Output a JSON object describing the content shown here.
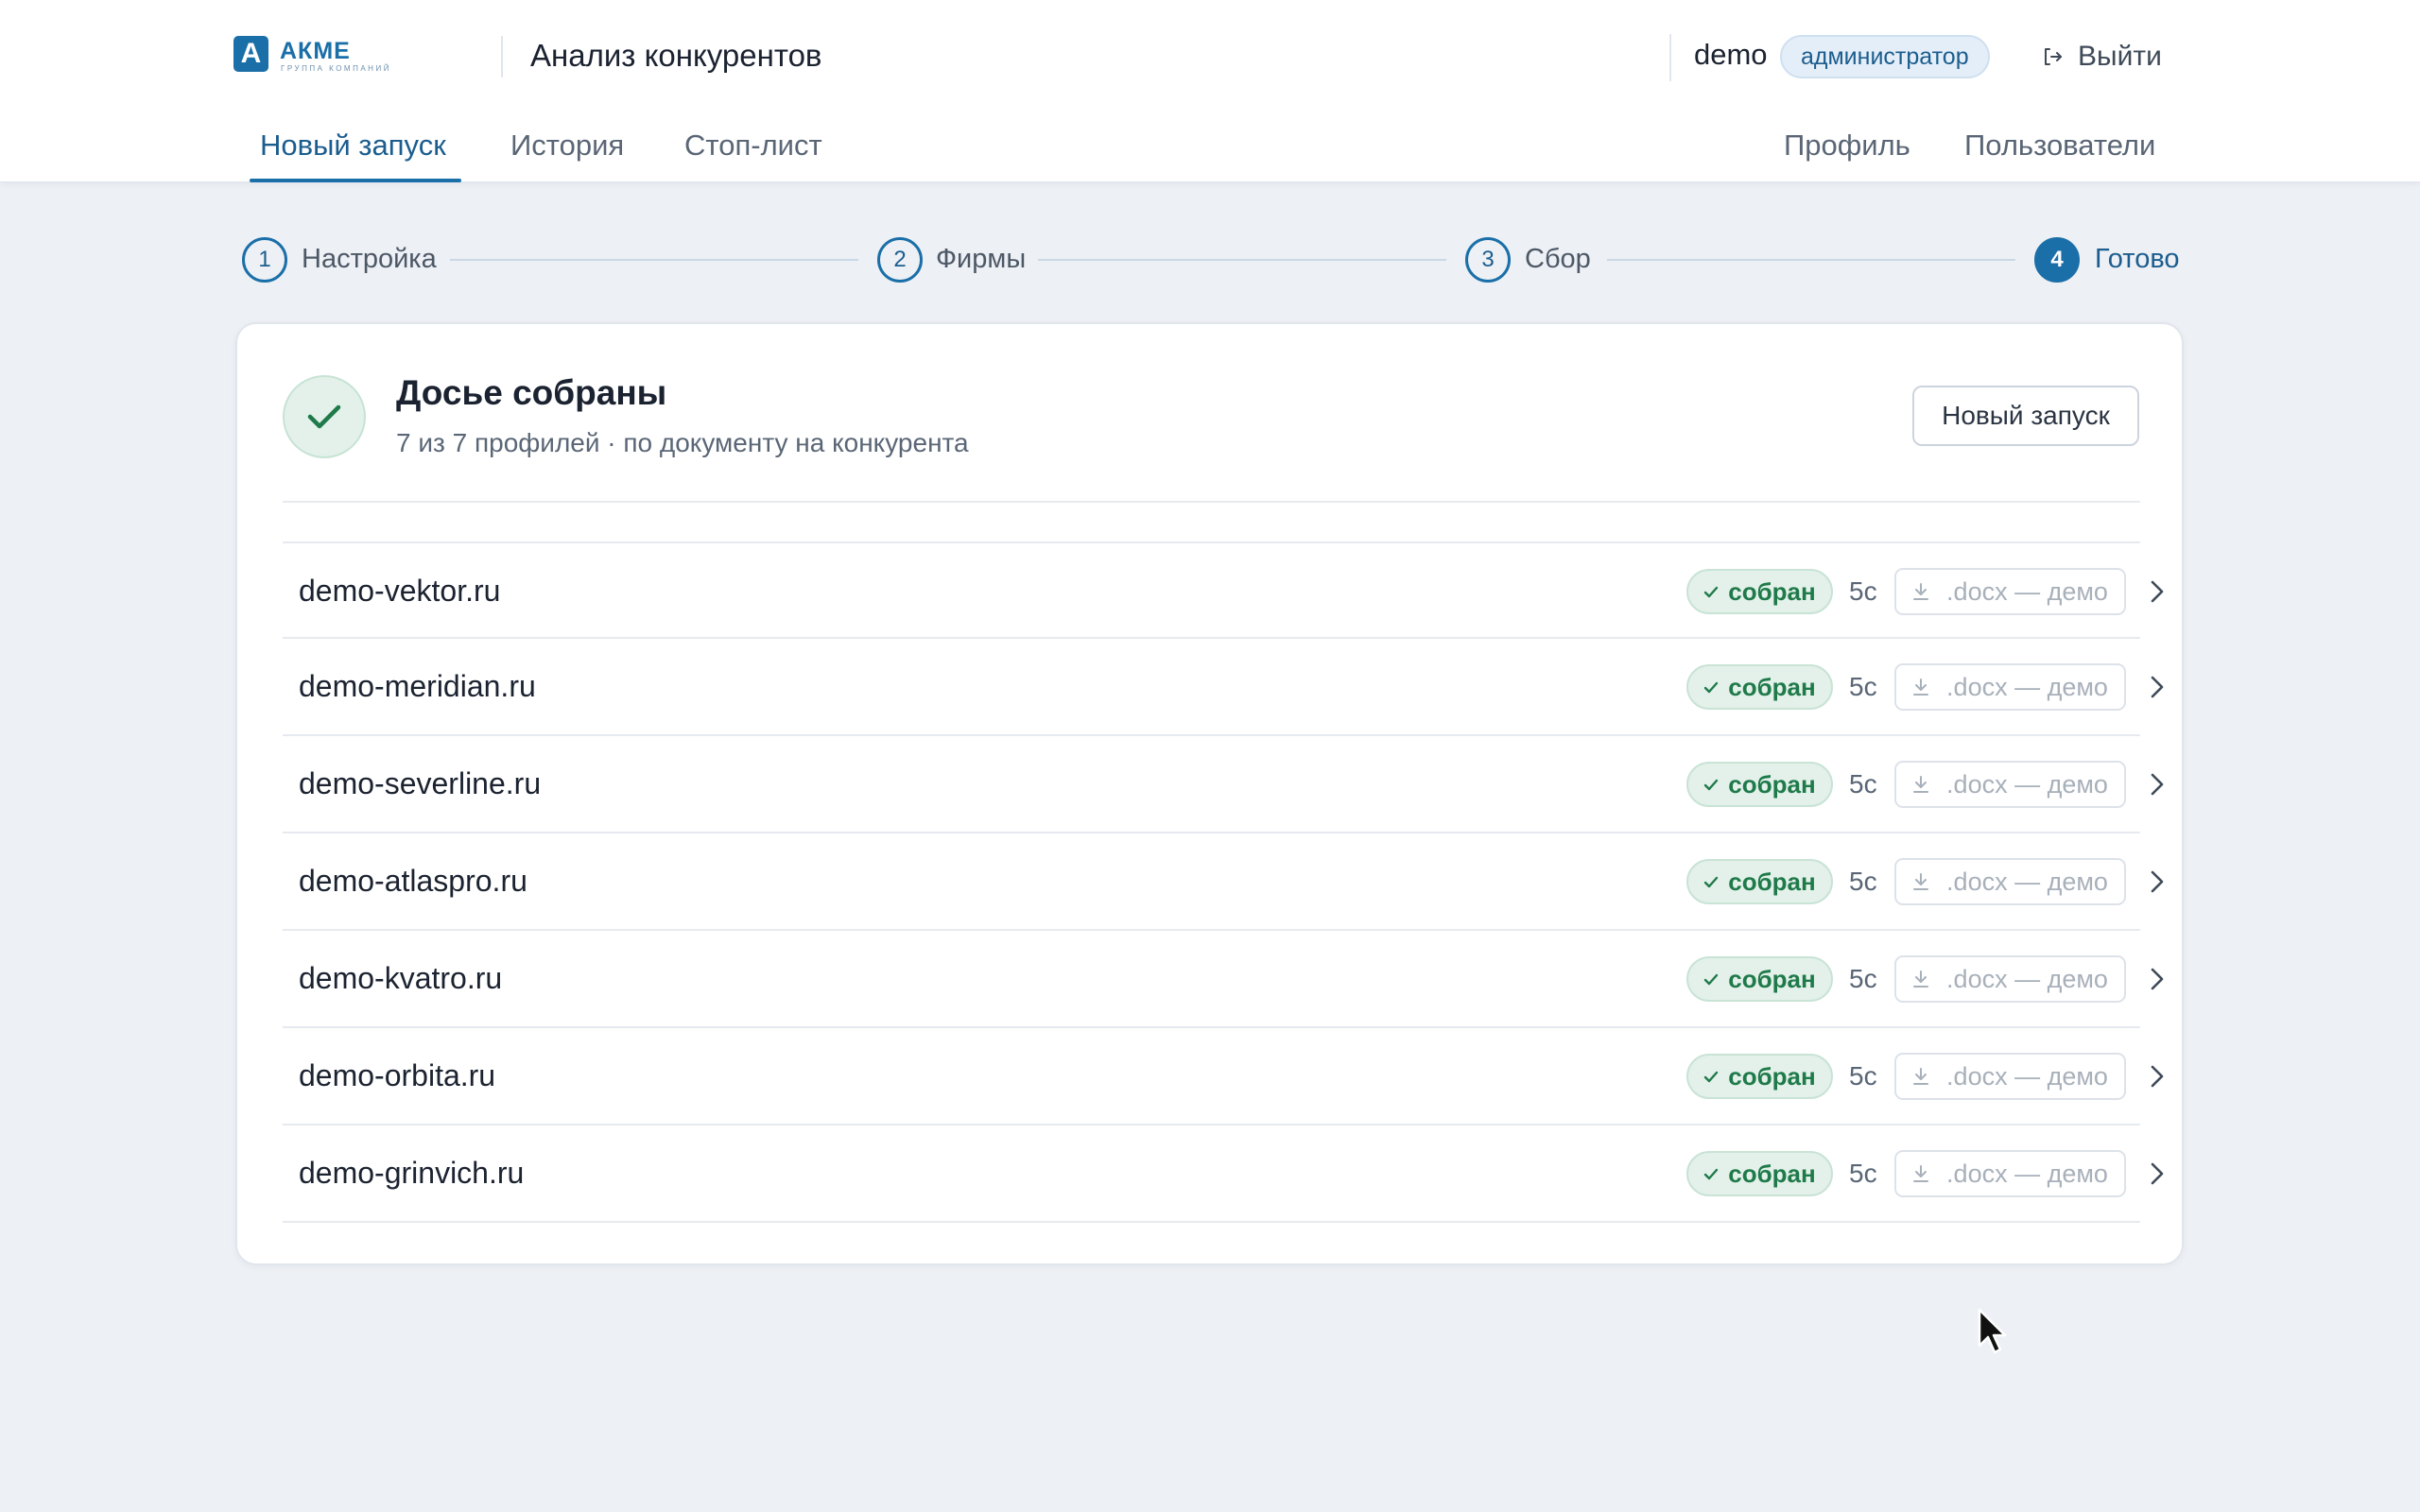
{
  "header": {
    "logo": {
      "mark": "A",
      "name": "АКМЕ",
      "sub": "группа компаний"
    },
    "app_title": "Анализ конкурентов",
    "user": "demo",
    "role": "администратор",
    "logout_label": "Выйти",
    "tabs_left": [
      {
        "label": "Новый запуск",
        "active": true
      },
      {
        "label": "История",
        "active": false
      },
      {
        "label": "Стоп-лист",
        "active": false
      }
    ],
    "tabs_right": [
      {
        "label": "Профиль"
      },
      {
        "label": "Пользователи"
      }
    ]
  },
  "stepper": [
    {
      "num": "1",
      "label": "Настройка"
    },
    {
      "num": "2",
      "label": "Фирмы"
    },
    {
      "num": "3",
      "label": "Сбор"
    },
    {
      "num": "4",
      "label": "Готово",
      "current": true
    }
  ],
  "result": {
    "title": "Досье собраны",
    "subtitle": "7 из 7 профилей · по документу на конкурента",
    "new_run_label": "Новый запуск"
  },
  "rows": [
    {
      "domain": "demo-vektor.ru",
      "status": "собран",
      "time": "5с",
      "download": ".docx — демо"
    },
    {
      "domain": "demo-meridian.ru",
      "status": "собран",
      "time": "5с",
      "download": ".docx — демо"
    },
    {
      "domain": "demo-severline.ru",
      "status": "собран",
      "time": "5с",
      "download": ".docx — демо"
    },
    {
      "domain": "demo-atlaspro.ru",
      "status": "собран",
      "time": "5с",
      "download": ".docx — демо"
    },
    {
      "domain": "demo-kvatro.ru",
      "status": "собран",
      "time": "5с",
      "download": ".docx — демо"
    },
    {
      "domain": "demo-orbita.ru",
      "status": "собран",
      "time": "5с",
      "download": ".docx — демо"
    },
    {
      "domain": "demo-grinvich.ru",
      "status": "собран",
      "time": "5с",
      "download": ".docx — демо"
    }
  ],
  "colors": {
    "accent": "#1b6fa8",
    "success": "#1f7a4a",
    "background": "#edf0f5"
  }
}
